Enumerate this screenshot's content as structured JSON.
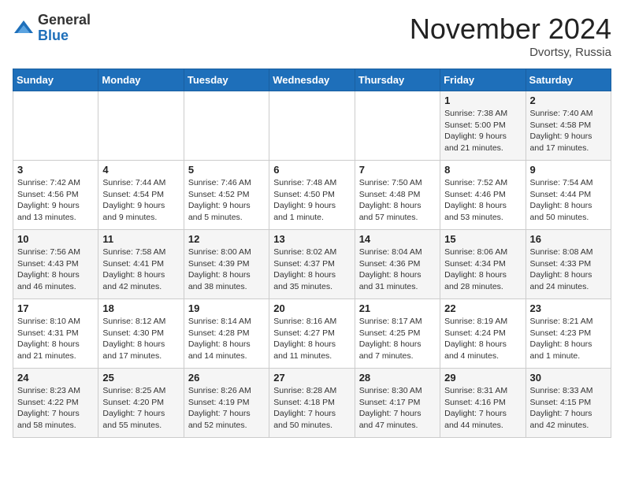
{
  "logo": {
    "general": "General",
    "blue": "Blue"
  },
  "header": {
    "month": "November 2024",
    "location": "Dvortsy, Russia"
  },
  "weekdays": [
    "Sunday",
    "Monday",
    "Tuesday",
    "Wednesday",
    "Thursday",
    "Friday",
    "Saturday"
  ],
  "weeks": [
    [
      {
        "day": "",
        "info": ""
      },
      {
        "day": "",
        "info": ""
      },
      {
        "day": "",
        "info": ""
      },
      {
        "day": "",
        "info": ""
      },
      {
        "day": "",
        "info": ""
      },
      {
        "day": "1",
        "info": "Sunrise: 7:38 AM\nSunset: 5:00 PM\nDaylight: 9 hours and 21 minutes."
      },
      {
        "day": "2",
        "info": "Sunrise: 7:40 AM\nSunset: 4:58 PM\nDaylight: 9 hours and 17 minutes."
      }
    ],
    [
      {
        "day": "3",
        "info": "Sunrise: 7:42 AM\nSunset: 4:56 PM\nDaylight: 9 hours and 13 minutes."
      },
      {
        "day": "4",
        "info": "Sunrise: 7:44 AM\nSunset: 4:54 PM\nDaylight: 9 hours and 9 minutes."
      },
      {
        "day": "5",
        "info": "Sunrise: 7:46 AM\nSunset: 4:52 PM\nDaylight: 9 hours and 5 minutes."
      },
      {
        "day": "6",
        "info": "Sunrise: 7:48 AM\nSunset: 4:50 PM\nDaylight: 9 hours and 1 minute."
      },
      {
        "day": "7",
        "info": "Sunrise: 7:50 AM\nSunset: 4:48 PM\nDaylight: 8 hours and 57 minutes."
      },
      {
        "day": "8",
        "info": "Sunrise: 7:52 AM\nSunset: 4:46 PM\nDaylight: 8 hours and 53 minutes."
      },
      {
        "day": "9",
        "info": "Sunrise: 7:54 AM\nSunset: 4:44 PM\nDaylight: 8 hours and 50 minutes."
      }
    ],
    [
      {
        "day": "10",
        "info": "Sunrise: 7:56 AM\nSunset: 4:43 PM\nDaylight: 8 hours and 46 minutes."
      },
      {
        "day": "11",
        "info": "Sunrise: 7:58 AM\nSunset: 4:41 PM\nDaylight: 8 hours and 42 minutes."
      },
      {
        "day": "12",
        "info": "Sunrise: 8:00 AM\nSunset: 4:39 PM\nDaylight: 8 hours and 38 minutes."
      },
      {
        "day": "13",
        "info": "Sunrise: 8:02 AM\nSunset: 4:37 PM\nDaylight: 8 hours and 35 minutes."
      },
      {
        "day": "14",
        "info": "Sunrise: 8:04 AM\nSunset: 4:36 PM\nDaylight: 8 hours and 31 minutes."
      },
      {
        "day": "15",
        "info": "Sunrise: 8:06 AM\nSunset: 4:34 PM\nDaylight: 8 hours and 28 minutes."
      },
      {
        "day": "16",
        "info": "Sunrise: 8:08 AM\nSunset: 4:33 PM\nDaylight: 8 hours and 24 minutes."
      }
    ],
    [
      {
        "day": "17",
        "info": "Sunrise: 8:10 AM\nSunset: 4:31 PM\nDaylight: 8 hours and 21 minutes."
      },
      {
        "day": "18",
        "info": "Sunrise: 8:12 AM\nSunset: 4:30 PM\nDaylight: 8 hours and 17 minutes."
      },
      {
        "day": "19",
        "info": "Sunrise: 8:14 AM\nSunset: 4:28 PM\nDaylight: 8 hours and 14 minutes."
      },
      {
        "day": "20",
        "info": "Sunrise: 8:16 AM\nSunset: 4:27 PM\nDaylight: 8 hours and 11 minutes."
      },
      {
        "day": "21",
        "info": "Sunrise: 8:17 AM\nSunset: 4:25 PM\nDaylight: 8 hours and 7 minutes."
      },
      {
        "day": "22",
        "info": "Sunrise: 8:19 AM\nSunset: 4:24 PM\nDaylight: 8 hours and 4 minutes."
      },
      {
        "day": "23",
        "info": "Sunrise: 8:21 AM\nSunset: 4:23 PM\nDaylight: 8 hours and 1 minute."
      }
    ],
    [
      {
        "day": "24",
        "info": "Sunrise: 8:23 AM\nSunset: 4:22 PM\nDaylight: 7 hours and 58 minutes."
      },
      {
        "day": "25",
        "info": "Sunrise: 8:25 AM\nSunset: 4:20 PM\nDaylight: 7 hours and 55 minutes."
      },
      {
        "day": "26",
        "info": "Sunrise: 8:26 AM\nSunset: 4:19 PM\nDaylight: 7 hours and 52 minutes."
      },
      {
        "day": "27",
        "info": "Sunrise: 8:28 AM\nSunset: 4:18 PM\nDaylight: 7 hours and 50 minutes."
      },
      {
        "day": "28",
        "info": "Sunrise: 8:30 AM\nSunset: 4:17 PM\nDaylight: 7 hours and 47 minutes."
      },
      {
        "day": "29",
        "info": "Sunrise: 8:31 AM\nSunset: 4:16 PM\nDaylight: 7 hours and 44 minutes."
      },
      {
        "day": "30",
        "info": "Sunrise: 8:33 AM\nSunset: 4:15 PM\nDaylight: 7 hours and 42 minutes."
      }
    ]
  ]
}
